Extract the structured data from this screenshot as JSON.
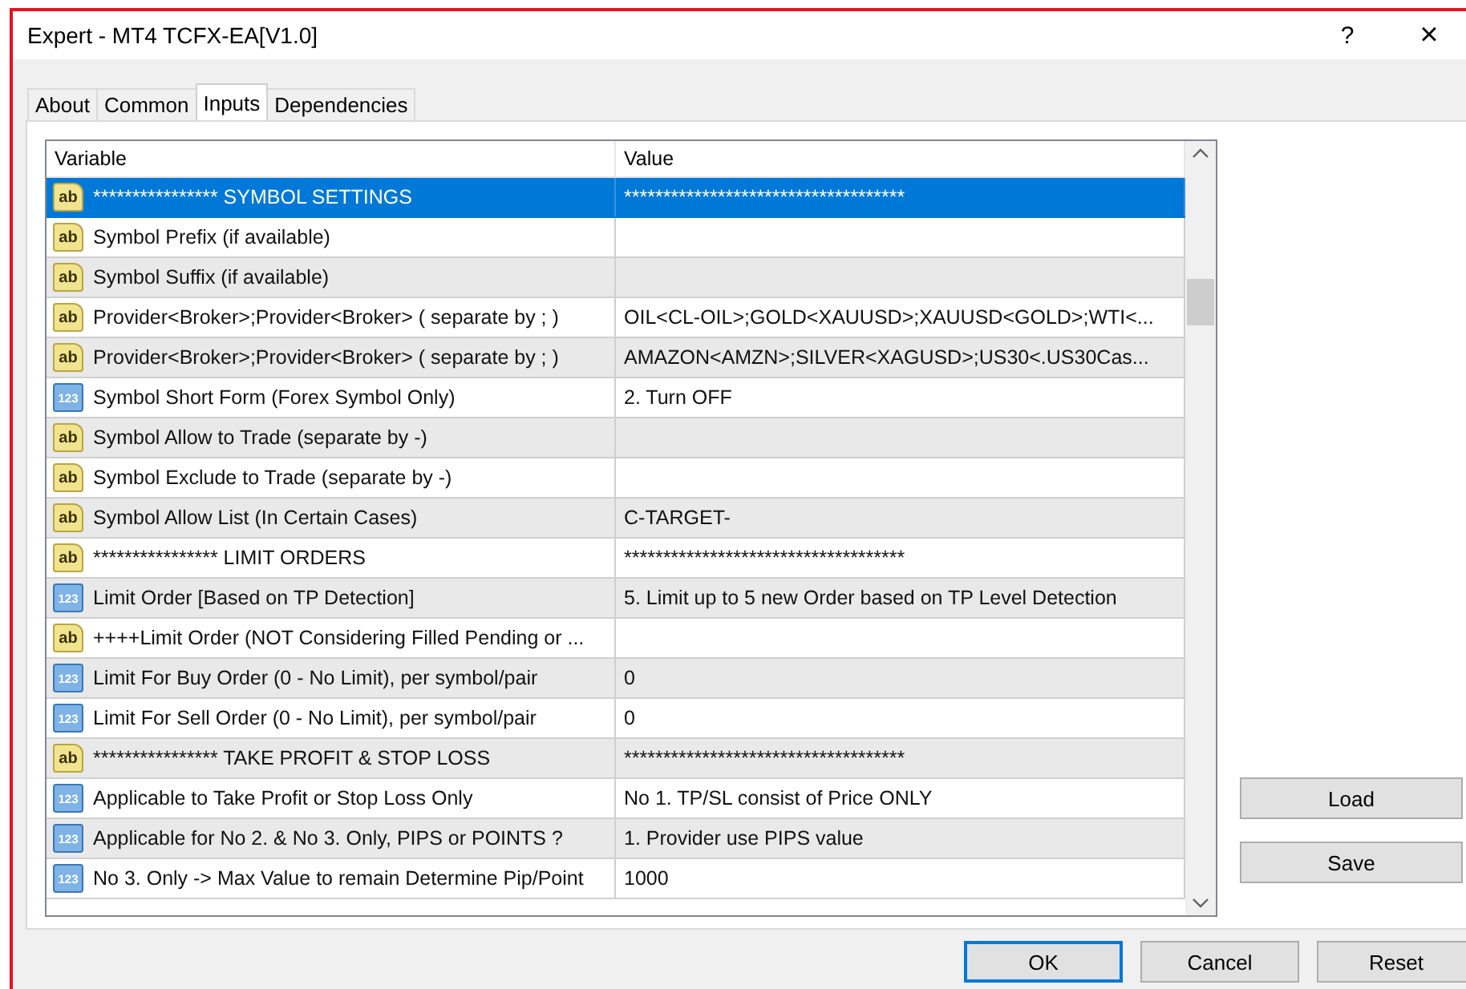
{
  "window": {
    "title": "Expert - MT4 TCFX-EA[V1.0]",
    "help_button": "?",
    "close_button": "×"
  },
  "tabs": [
    {
      "label": "About",
      "selected": false
    },
    {
      "label": "Common",
      "selected": false
    },
    {
      "label": "Inputs",
      "selected": true
    },
    {
      "label": "Dependencies",
      "selected": false
    }
  ],
  "table": {
    "columns": [
      "Variable",
      "Value"
    ],
    "rows": [
      {
        "kind": "text",
        "type_label": "ab",
        "variable": "**************** SYMBOL SETTINGS",
        "value": "************************************",
        "selected": true
      },
      {
        "kind": "text",
        "type_label": "ab",
        "variable": "Symbol Prefix (if available)",
        "selected": false
      },
      {
        "kind": "text",
        "type_label": "ab",
        "variable": "Symbol Suffix (if available)",
        "selected": false
      },
      {
        "kind": "text",
        "type_label": "ab",
        "variable": "Provider<Broker>;Provider<Broker> ( separate by ; )",
        "value": "OIL<CL-OIL>;GOLD<XAUUSD>;XAUUSD<GOLD>;WTI<...",
        "selected": false
      },
      {
        "kind": "text",
        "type_label": "ab",
        "variable": "Provider<Broker>;Provider<Broker> ( separate by ; )",
        "value": "AMAZON<AMZN>;SILVER<XAGUSD>;US30<.US30Cas...",
        "selected": false
      },
      {
        "kind": "number",
        "type_label": "123",
        "variable": "Symbol Short Form (Forex Symbol Only)",
        "value": "2. Turn OFF",
        "selected": false
      },
      {
        "kind": "text",
        "type_label": "ab",
        "variable": "Symbol Allow to Trade (separate by -)",
        "selected": false
      },
      {
        "kind": "text",
        "type_label": "ab",
        "variable": "Symbol Exclude to Trade (separate by -)",
        "selected": false
      },
      {
        "kind": "text",
        "type_label": "ab",
        "variable": "Symbol Allow List (In Certain Cases)",
        "value": "C-TARGET-",
        "selected": false
      },
      {
        "kind": "text",
        "type_label": "ab",
        "variable": "**************** LIMIT ORDERS",
        "value": "************************************",
        "selected": false
      },
      {
        "kind": "number",
        "type_label": "123",
        "variable": "Limit Order [Based on TP Detection]",
        "value": "5. Limit up to 5 new Order based on TP Level Detection",
        "selected": false
      },
      {
        "kind": "text",
        "type_label": "ab",
        "variable": "++++Limit Order (NOT Considering Filled Pending or ...",
        "selected": false
      },
      {
        "kind": "number",
        "type_label": "123",
        "variable": "Limit For Buy Order (0 - No Limit), per symbol/pair",
        "value": "0",
        "selected": false
      },
      {
        "kind": "number",
        "type_label": "123",
        "variable": "Limit For Sell Order (0 - No Limit), per symbol/pair",
        "value": "0",
        "selected": false
      },
      {
        "kind": "text",
        "type_label": "ab",
        "variable": "**************** TAKE PROFIT & STOP LOSS",
        "value": "************************************",
        "selected": false
      },
      {
        "kind": "number",
        "type_label": "123",
        "variable": "Applicable to Take Profit or Stop Loss Only",
        "value": "No 1. TP/SL consist of Price ONLY",
        "selected": false
      },
      {
        "kind": "number",
        "type_label": "123",
        "variable": "Applicable for No 2. & No 3. Only, PIPS or POINTS ?",
        "value": "1. Provider use PIPS value",
        "selected": false
      },
      {
        "kind": "number",
        "type_label": "123",
        "variable": "No 3. Only -> Max Value to remain Determine Pip/Point",
        "value": "1000",
        "selected": false
      }
    ]
  },
  "side_buttons": [
    "Load",
    "Save"
  ],
  "dialog_buttons": [
    {
      "label": "OK",
      "default": true
    },
    {
      "label": "Cancel",
      "default": false
    },
    {
      "label": "Reset",
      "default": false
    }
  ]
}
